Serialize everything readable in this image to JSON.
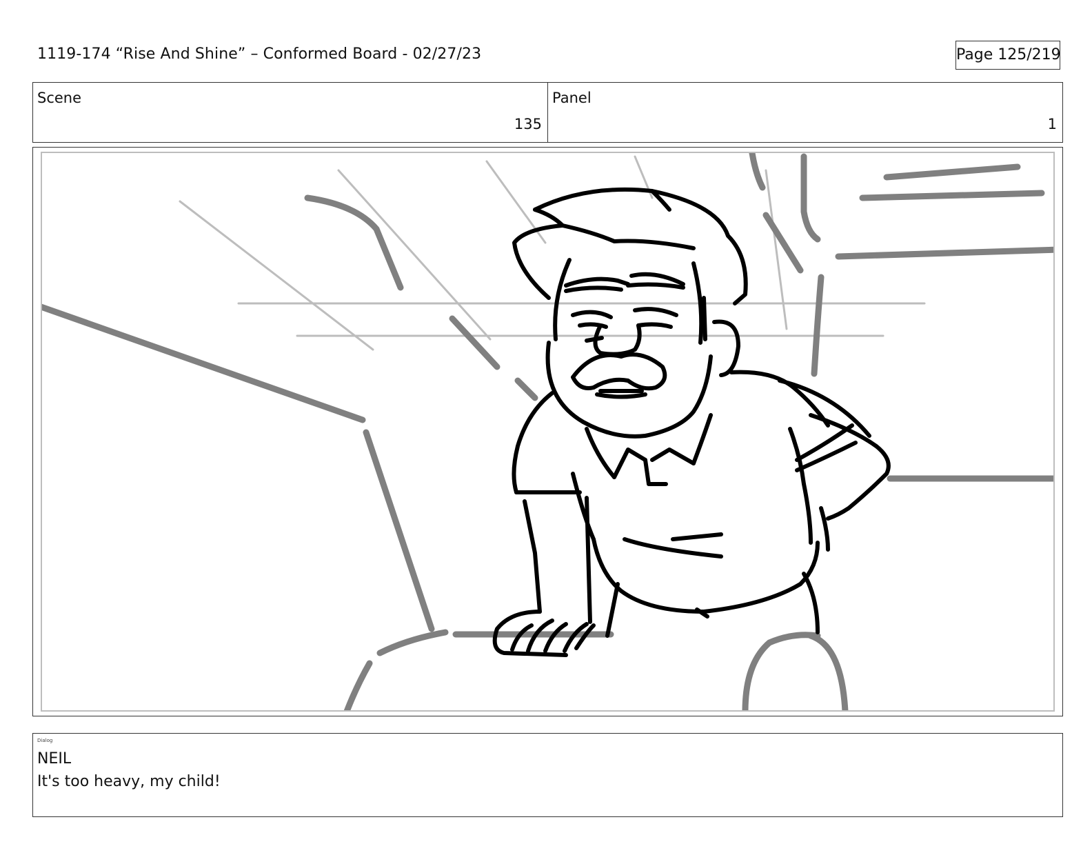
{
  "document": {
    "title": "1119-174 “Rise And Shine” – Conformed Board - 02/27/23",
    "page_indicator": "Page 125/219"
  },
  "header": {
    "scene_label": "Scene",
    "scene_value": "135",
    "panel_label": "Panel",
    "panel_value": "1"
  },
  "drawing": {
    "subject": "storyboard sketch of a mustached man in a polo shirt leaning forward over a rock",
    "line_color": "#000000",
    "background_line_color": "#808080",
    "guide_line_color": "#bdbdbd"
  },
  "dialog": {
    "tag": "Dialog",
    "speaker": "NEIL",
    "line": "It's too heavy, my child!"
  }
}
